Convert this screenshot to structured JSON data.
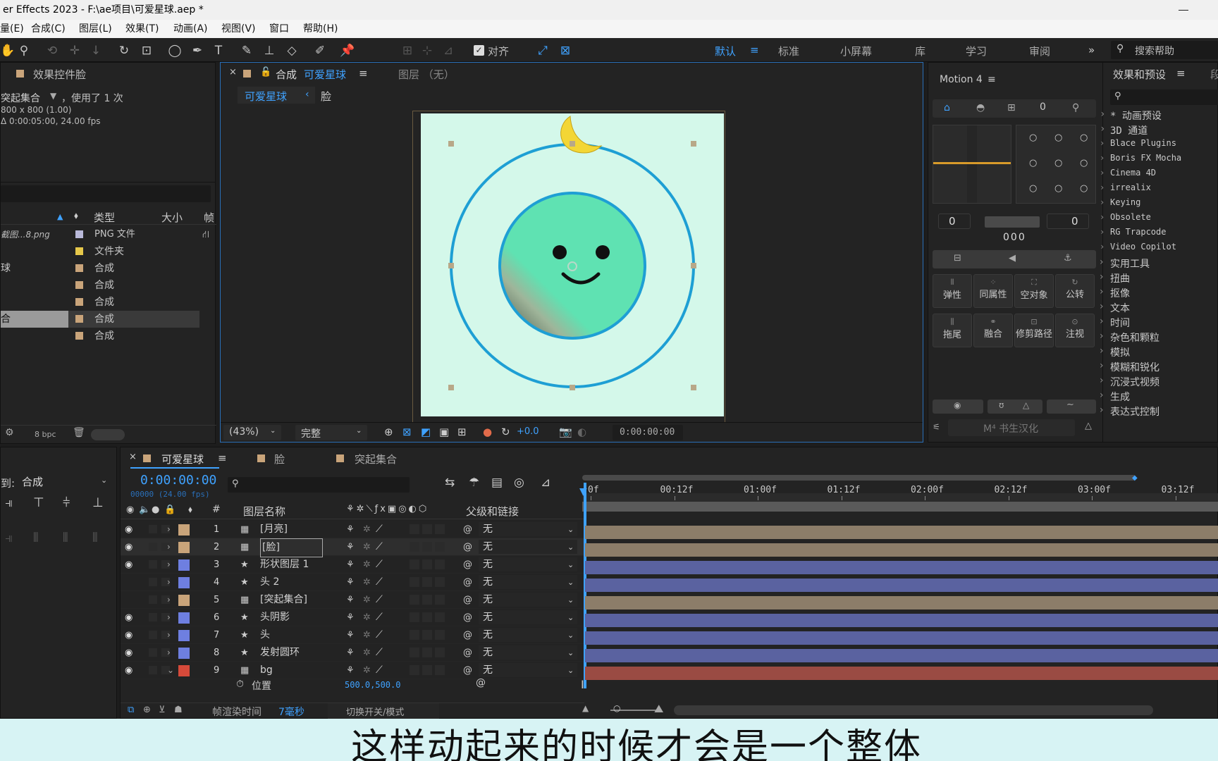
{
  "app": {
    "title": "er Effects 2023 - F:\\ae项目\\可爱星球.aep *"
  },
  "menu": [
    "量(E)",
    "合成(C)",
    "图层(L)",
    "效果(T)",
    "动画(A)",
    "视图(V)",
    "窗口",
    "帮助(H)"
  ],
  "toolbar": {
    "align_label": "对齐",
    "workspaces": [
      "默认",
      "标准",
      "小屏幕",
      "库",
      "学习",
      "审阅"
    ],
    "active_workspace": "默认",
    "search_placeholder": "搜索帮助"
  },
  "effect_controls": {
    "title": "效果控件脸",
    "comp_name": "突起集合",
    "used": "，使用了 1 次",
    "dims": "800 x 800 (1.00)",
    "duration": "Δ 0:00:05:00, 24.00 fps"
  },
  "project": {
    "col_type": "类型",
    "col_size": "大小",
    "col_frame": "帧",
    "items": [
      {
        "name": "截图...8.png",
        "type": "PNG 文件",
        "color": "#b9b9d9"
      },
      {
        "name": "",
        "type": "文件夹",
        "color": "#e6c84a"
      },
      {
        "name": "球",
        "type": "合成",
        "color": "#c9a47a"
      },
      {
        "name": "",
        "type": "合成",
        "color": "#c9a47a"
      },
      {
        "name": "",
        "type": "合成",
        "color": "#c9a47a"
      },
      {
        "name": "合",
        "type": "合成",
        "color": "#c9a47a"
      },
      {
        "name": "",
        "type": "合成",
        "color": "#c9a47a"
      }
    ],
    "bpc": "8 bpc"
  },
  "composition": {
    "tab_label": "合成",
    "tab_name": "可爱星球",
    "layer_tab": "图层 （无）",
    "breadcrumb_1": "可爱星球",
    "breadcrumb_2": "脸",
    "zoom": "(43%)",
    "quality": "完整",
    "exposure": "+0.0",
    "timecode": "0:00:00:00",
    "bg_color": "#d4f8ea",
    "ring_color": "#1e9fd4",
    "face_color": "#5fe2b2"
  },
  "motion": {
    "title": "Motion 4",
    "val_left": "0",
    "val_right": "0",
    "val_mid": "000",
    "buttons": [
      "弹性",
      "同属性",
      "空对象",
      "公转",
      "拖尾",
      "融合",
      "修剪路径",
      "注视"
    ],
    "footer": "M⁴ 书生汉化"
  },
  "effects_presets": {
    "title": "效果和预设",
    "tab2": "段",
    "items": [
      "* 动画预设",
      "3D 通道",
      "Blace Plugins",
      "Boris FX Mocha",
      "Cinema 4D",
      "irrealix",
      "Keying",
      "Obsolete",
      "RG Trapcode",
      "Video Copilot",
      "实用工具",
      "扭曲",
      "抠像",
      "文本",
      "时间",
      "杂色和颗粒",
      "模拟",
      "模糊和锐化",
      "沉浸式视频",
      "生成",
      "表达式控制"
    ]
  },
  "timeline": {
    "tabs": [
      "可爱星球",
      "脸",
      "突起集合"
    ],
    "left_label": "到:",
    "left_select": "合成",
    "timecode": "0:00:00:00",
    "fps": "00000 (24.00 fps)",
    "col_num": "#",
    "col_name": "图层名称",
    "col_parent": "父级和链接",
    "ticks": [
      "0f",
      "00:12f",
      "01:00f",
      "01:12f",
      "02:00f",
      "02:12f",
      "03:00f",
      "03:12f"
    ],
    "layers": [
      {
        "num": "1",
        "name": "[月亮]",
        "color": "#c9a47a",
        "parent": "无"
      },
      {
        "num": "2",
        "name": "[脸]",
        "color": "#c9a47a",
        "parent": "无"
      },
      {
        "num": "3",
        "name": "形状图层 1",
        "color": "#6e7fe0",
        "parent": "无"
      },
      {
        "num": "4",
        "name": "头 2",
        "color": "#6e7fe0",
        "parent": "无"
      },
      {
        "num": "5",
        "name": "[突起集合]",
        "color": "#c9a47a",
        "parent": "无"
      },
      {
        "num": "6",
        "name": "头阴影",
        "color": "#6e7fe0",
        "parent": "无"
      },
      {
        "num": "7",
        "name": "头",
        "color": "#6e7fe0",
        "parent": "无"
      },
      {
        "num": "8",
        "name": "发射圆环",
        "color": "#6e7fe0",
        "parent": "无"
      },
      {
        "num": "9",
        "name": "bg",
        "color": "#d64a3a",
        "parent": "无"
      }
    ],
    "prop_name": "位置",
    "prop_value": "500.0,500.0",
    "render_label": "帧渲染时间",
    "render_value": "7毫秒",
    "switch_label": "切换开关/模式"
  },
  "subtitle": "这样动起来的时候才会是一个整体"
}
